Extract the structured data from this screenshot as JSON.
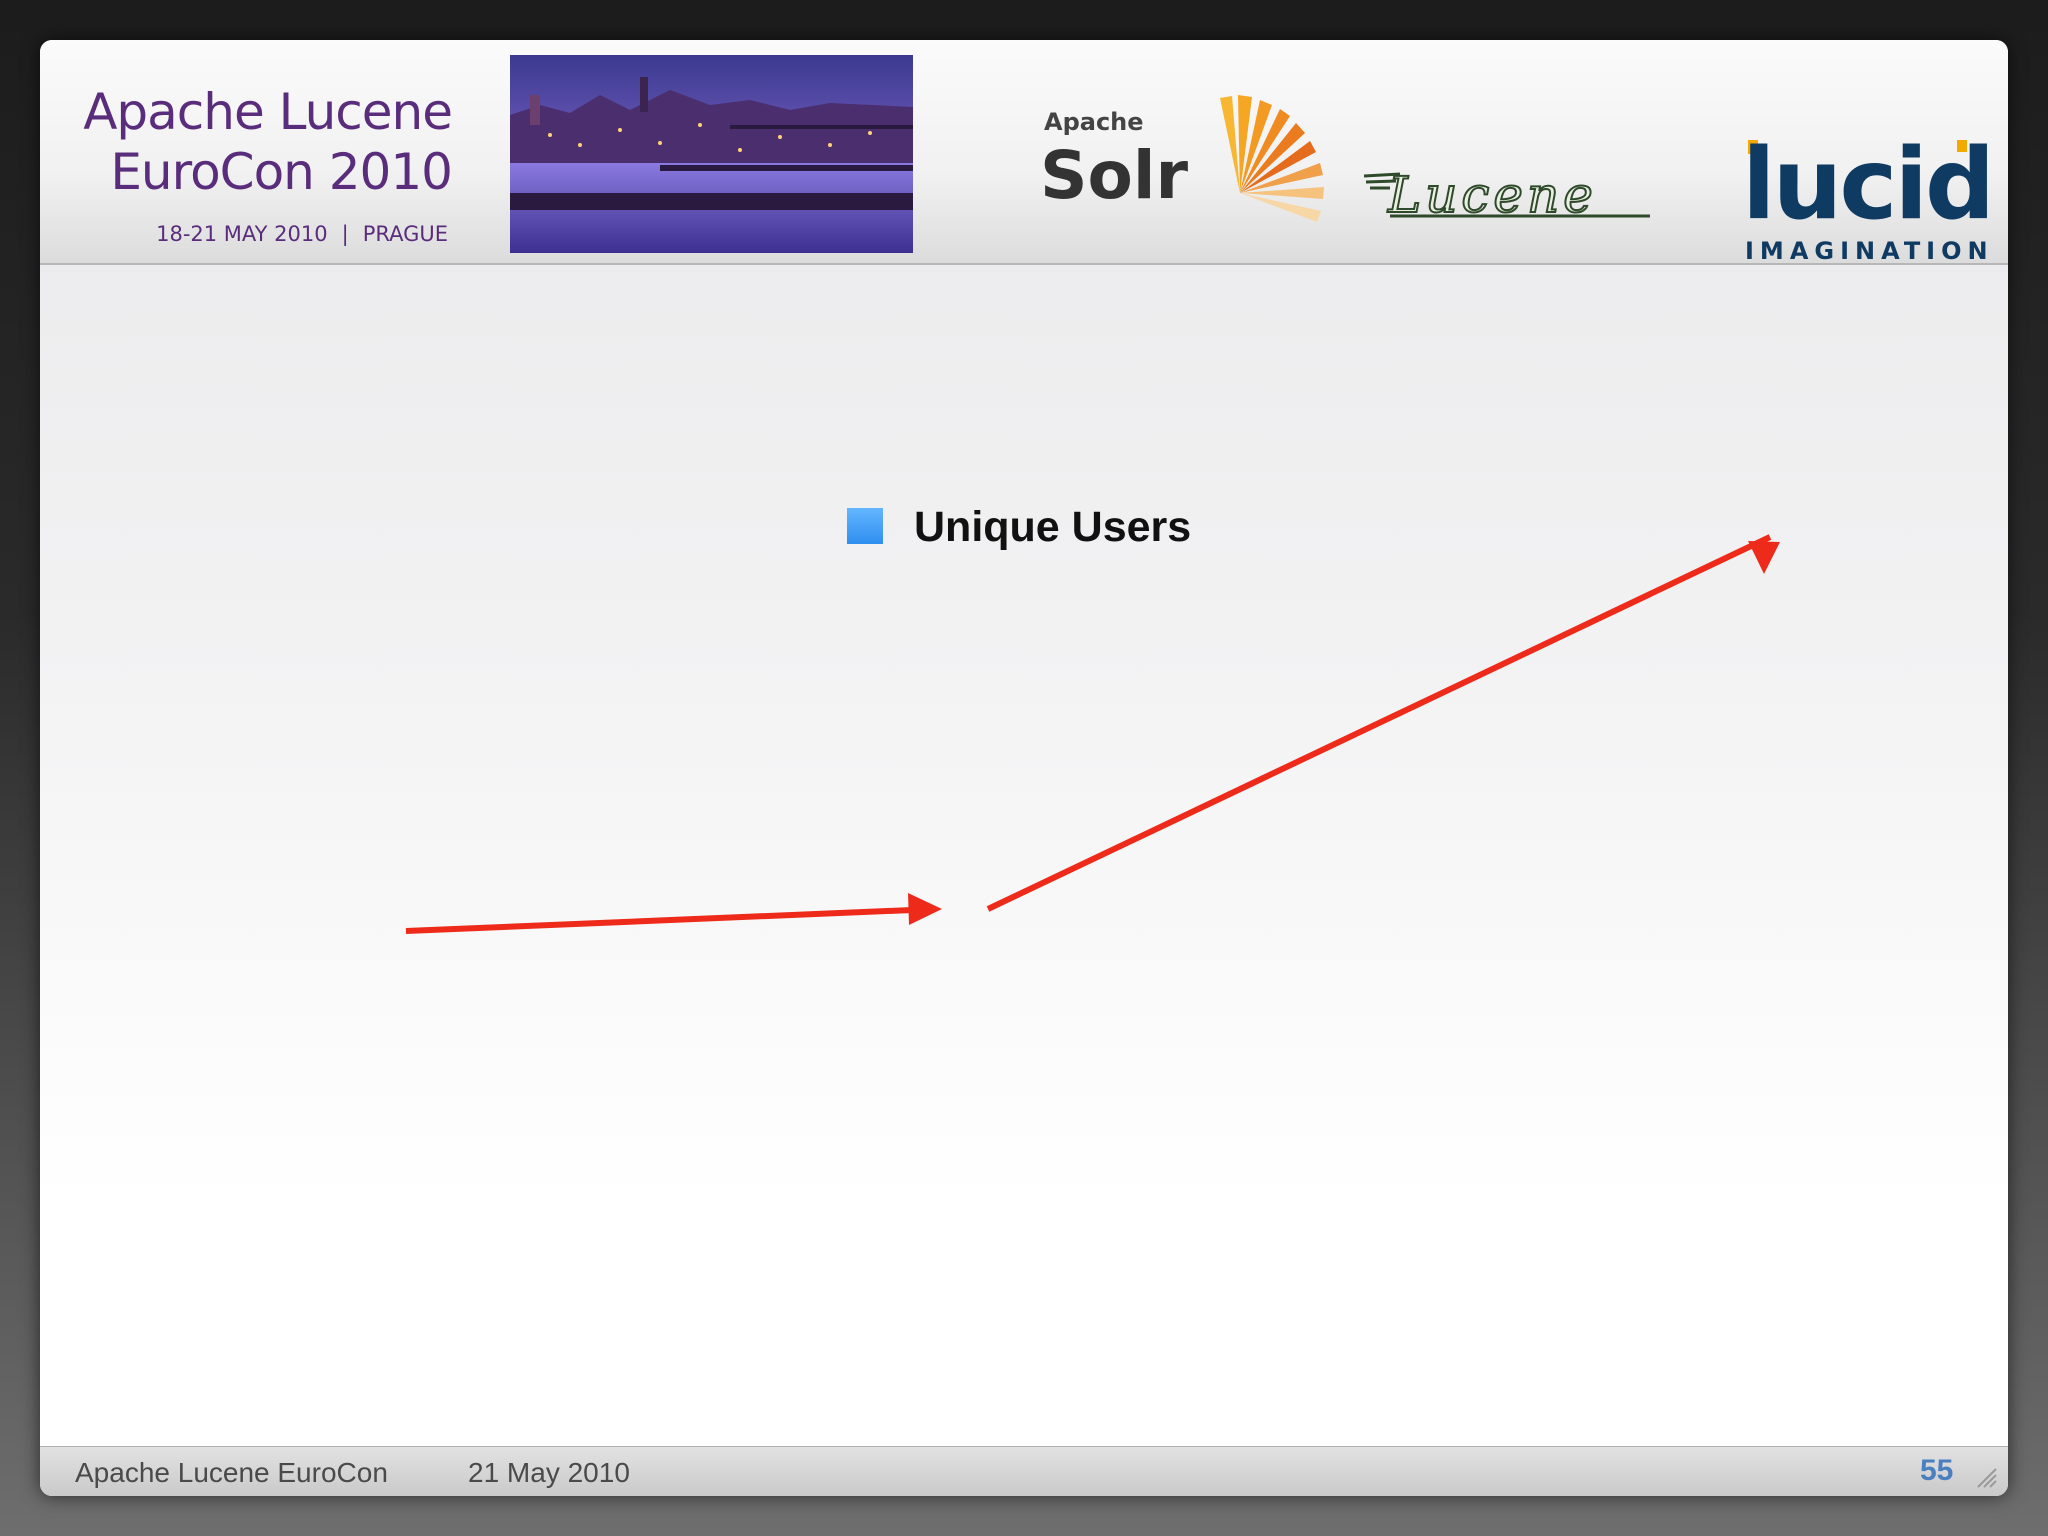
{
  "header": {
    "title_line1": "Apache Lucene",
    "title_line2": "EuroCon 2010",
    "dates": "18-21 MAY 2010",
    "separator": "|",
    "city": "PRAGUE",
    "logos": {
      "solr_small": "Apache",
      "solr_big": "Solr",
      "lucene": "Lucene",
      "lucid_big": "lucid",
      "lucid_small": "IMAGINATION"
    }
  },
  "legend": {
    "label": "Unique Users",
    "color": "#3a9cf7"
  },
  "arrows": {
    "color": "#ee2a1a"
  },
  "footer": {
    "name": "Apache Lucene EuroCon",
    "date": "21 May 2010",
    "page": "55"
  }
}
